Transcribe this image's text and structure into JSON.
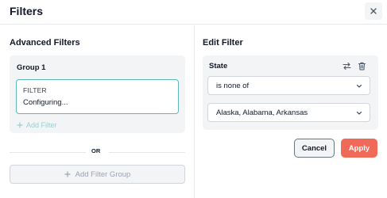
{
  "header": {
    "title": "Filters"
  },
  "left": {
    "section_title": "Advanced Filters",
    "group": {
      "title": "Group 1",
      "filter": {
        "label": "FILTER",
        "status": "Configuring..."
      },
      "add_filter_label": "Add Filter"
    },
    "divider_label": "OR",
    "add_group_label": "Add Filter Group"
  },
  "right": {
    "section_title": "Edit Filter",
    "field_label": "State",
    "operator_value": "is none of",
    "values_value": "Alaska, Alabama, Arkansas",
    "cancel_label": "Cancel",
    "apply_label": "Apply"
  },
  "colors": {
    "accent_teal": "#5eb7b7",
    "apply_red": "#f06a5a",
    "panel_gray": "#f3f4f6"
  },
  "icons": {
    "close": "close-icon",
    "swap": "swap-icon",
    "delete": "trash-icon",
    "chevron": "chevron-down-icon",
    "plus": "plus-icon"
  }
}
